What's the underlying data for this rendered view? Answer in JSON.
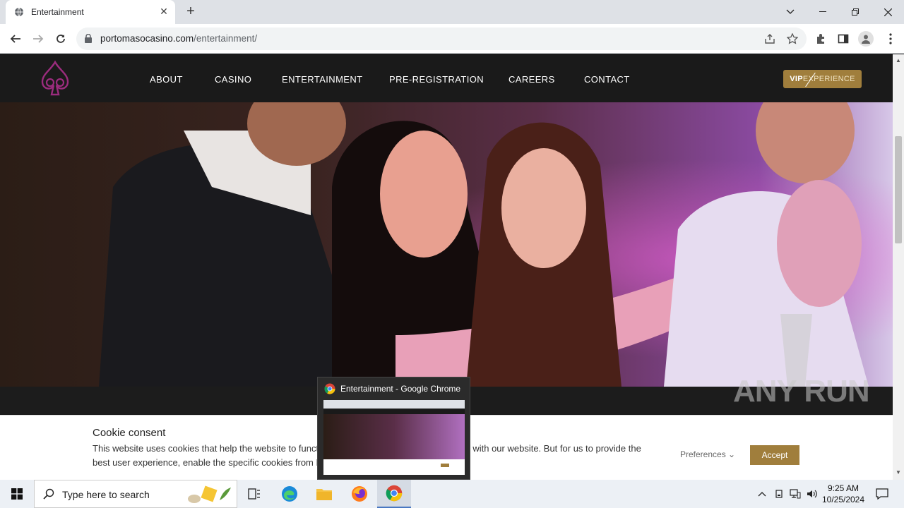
{
  "browser": {
    "tab_title": "Entertainment",
    "url_domain": "portomasocasino.com",
    "url_path": "/entertainment/"
  },
  "site_nav": {
    "links": [
      "ABOUT",
      "CASINO",
      "ENTERTAINMENT",
      "PRE-REGISTRATION",
      "CAREERS",
      "CONTACT"
    ],
    "vip_bold": "VIP",
    "vip_rest": "EXPERIENCE"
  },
  "cookie": {
    "title": "Cookie consent",
    "text": "This website uses cookies that help the website to function and also to track how you interact with our website. But for us to provide the best user experience, enable the specific cookies from Preferences, and click on Accept.",
    "preferences": "Preferences",
    "accept": "Accept"
  },
  "thumbnail": {
    "title": "Entertainment - Google Chrome"
  },
  "watermark": "ANY RUN",
  "taskbar": {
    "search_placeholder": "Type here to search",
    "time": "9:25 AM",
    "date": "10/25/2024"
  },
  "colors": {
    "accent_gold": "#a07e3c",
    "logo_purple": "#9b2c7e"
  }
}
